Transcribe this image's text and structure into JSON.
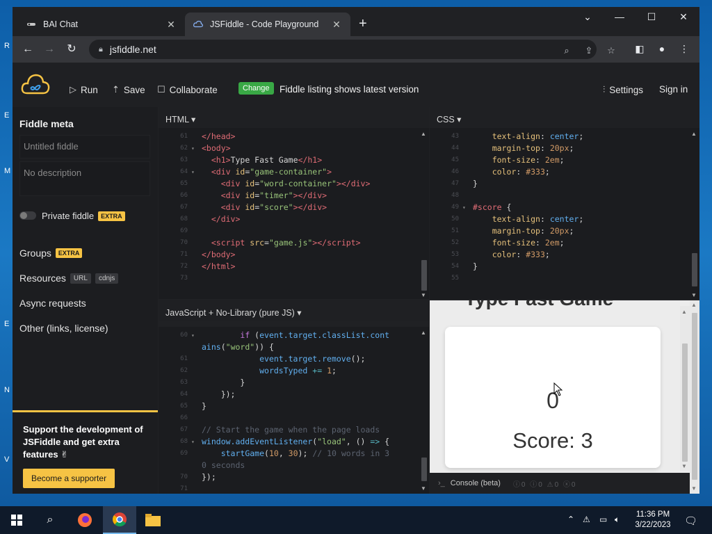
{
  "browser": {
    "tabs": [
      {
        "label": "BAI Chat",
        "active": false
      },
      {
        "label": "JSFiddle - Code Playground",
        "active": true
      }
    ],
    "url": "jsfiddle.net"
  },
  "header": {
    "run": "Run",
    "save": "Save",
    "collaborate": "Collaborate",
    "change_badge": "Change",
    "listing": "Fiddle listing shows latest version",
    "settings": "Settings",
    "sign_in": "Sign in"
  },
  "sidebar": {
    "title": "Fiddle meta",
    "title_placeholder": "Untitled fiddle",
    "description_placeholder": "No description",
    "private": "Private fiddle",
    "extra": "EXTRA",
    "groups": "Groups",
    "resources": "Resources",
    "url_pill": "URL",
    "cdnjs_pill": "cdnjs",
    "async": "Async requests",
    "other": "Other (links, license)",
    "support_text": "Support the development of JSFiddle and get extra features ✌",
    "support_button": "Become a supporter"
  },
  "panels": {
    "html_label": "HTML ▾",
    "css_label": "CSS ▾",
    "js_label": "JavaScript + No-Library (pure JS) ▾"
  },
  "html_lines": [
    {
      "n": "61",
      "fold": "",
      "html": "<span class='t-tag'>&lt;/head&gt;</span>"
    },
    {
      "n": "62",
      "fold": "▾",
      "html": "<span class='t-tag'>&lt;body&gt;</span>"
    },
    {
      "n": "63",
      "fold": "",
      "html": "  <span class='t-tag'>&lt;h1&gt;</span><span class='t-txt'>Type Fast Game</span><span class='t-tag'>&lt;/h1&gt;</span>"
    },
    {
      "n": "64",
      "fold": "▾",
      "html": "  <span class='t-tag'>&lt;div</span> <span class='t-attr'>id</span>=<span class='t-str'>\"game-container\"</span><span class='t-tag'>&gt;</span>"
    },
    {
      "n": "65",
      "fold": "",
      "html": "    <span class='t-tag'>&lt;div</span> <span class='t-attr'>id</span>=<span class='t-str'>\"word-container\"</span><span class='t-tag'>&gt;&lt;/div&gt;</span>"
    },
    {
      "n": "66",
      "fold": "",
      "html": "    <span class='t-tag'>&lt;div</span> <span class='t-attr'>id</span>=<span class='t-str'>\"timer\"</span><span class='t-tag'>&gt;&lt;/div&gt;</span>"
    },
    {
      "n": "67",
      "fold": "",
      "html": "    <span class='t-tag'>&lt;div</span> <span class='t-attr'>id</span>=<span class='t-str'>\"score\"</span><span class='t-tag'>&gt;&lt;/div&gt;</span>"
    },
    {
      "n": "68",
      "fold": "",
      "html": "  <span class='t-tag'>&lt;/div&gt;</span>"
    },
    {
      "n": "69",
      "fold": "",
      "html": ""
    },
    {
      "n": "70",
      "fold": "",
      "html": "  <span class='t-tag'>&lt;script</span> <span class='t-attr'>src</span>=<span class='t-str'>\"game.js\"</span><span class='t-tag'>&gt;&lt;/script&gt;</span>"
    },
    {
      "n": "71",
      "fold": "",
      "html": "<span class='t-tag'>&lt;/body&gt;</span>"
    },
    {
      "n": "72",
      "fold": "",
      "html": "<span class='t-tag'>&lt;/html&gt;</span>"
    },
    {
      "n": "73",
      "fold": "",
      "html": ""
    }
  ],
  "css_lines": [
    {
      "n": "43",
      "fold": "",
      "html": "    <span class='c-prop'>text-align</span>: <span class='c-val'>center</span>;"
    },
    {
      "n": "44",
      "fold": "",
      "html": "    <span class='c-prop'>margin-top</span>: <span class='c-num'>20px</span>;"
    },
    {
      "n": "45",
      "fold": "",
      "html": "    <span class='c-prop'>font-size</span>: <span class='c-num'>2em</span>;"
    },
    {
      "n": "46",
      "fold": "",
      "html": "    <span class='c-prop'>color</span>: <span class='c-num'>#333</span>;"
    },
    {
      "n": "47",
      "fold": "",
      "html": "}"
    },
    {
      "n": "48",
      "fold": "",
      "html": ""
    },
    {
      "n": "49",
      "fold": "▾",
      "html": "<span class='c-sel'>#score</span> {"
    },
    {
      "n": "50",
      "fold": "",
      "html": "    <span class='c-prop'>text-align</span>: <span class='c-val'>center</span>;"
    },
    {
      "n": "51",
      "fold": "",
      "html": "    <span class='c-prop'>margin-top</span>: <span class='c-num'>20px</span>;"
    },
    {
      "n": "52",
      "fold": "",
      "html": "    <span class='c-prop'>font-size</span>: <span class='c-num'>2em</span>;"
    },
    {
      "n": "53",
      "fold": "",
      "html": "    <span class='c-prop'>color</span>: <span class='c-num'>#333</span>;"
    },
    {
      "n": "54",
      "fold": "",
      "html": "}"
    },
    {
      "n": "55",
      "fold": "",
      "html": ""
    }
  ],
  "js_lines": [
    {
      "n": "60",
      "fold": "▾",
      "html": "        <span class='j-kw'>if</span> (<span class='j-fn'>event.target.classList.cont</span>"
    },
    {
      "n": "",
      "fold": "",
      "html": "<span class='j-fn'>ains</span>(<span class='j-str'>\"word\"</span>)) {"
    },
    {
      "n": "61",
      "fold": "",
      "html": "            <span class='j-fn'>event.target.remove</span>();"
    },
    {
      "n": "62",
      "fold": "",
      "html": "            <span class='j-fn'>wordsTyped</span> <span class='j-op'>+=</span> <span class='j-num'>1</span>;"
    },
    {
      "n": "63",
      "fold": "",
      "html": "        }"
    },
    {
      "n": "64",
      "fold": "",
      "html": "    });"
    },
    {
      "n": "65",
      "fold": "",
      "html": "}"
    },
    {
      "n": "66",
      "fold": "",
      "html": ""
    },
    {
      "n": "67",
      "fold": "",
      "html": "<span class='j-cm'>// Start the game when the page loads</span>"
    },
    {
      "n": "68",
      "fold": "▾",
      "html": "<span class='j-fn'>window.addEventListener</span>(<span class='j-str'>\"load\"</span>, () <span class='j-op'>=&gt;</span> {"
    },
    {
      "n": "69",
      "fold": "",
      "html": "    <span class='j-fn'>startGame</span>(<span class='j-num'>10</span>, <span class='j-num'>30</span>); <span class='j-cm'>// 10 words in 3</span>"
    },
    {
      "n": "",
      "fold": "",
      "html": "<span class='j-cm'>0 seconds</span>"
    },
    {
      "n": "70",
      "fold": "",
      "html": "});"
    },
    {
      "n": "71",
      "fold": "",
      "html": ""
    }
  ],
  "result": {
    "heading": "Type Fast Game",
    "timer": "0",
    "score": "Score: 3"
  },
  "console": {
    "label": "Console (beta)",
    "counts": "ⓘ0 ⓘ0 ⚠0 ⓧ0"
  },
  "taskbar": {
    "time": "11:36 PM",
    "date": "3/22/2023"
  }
}
